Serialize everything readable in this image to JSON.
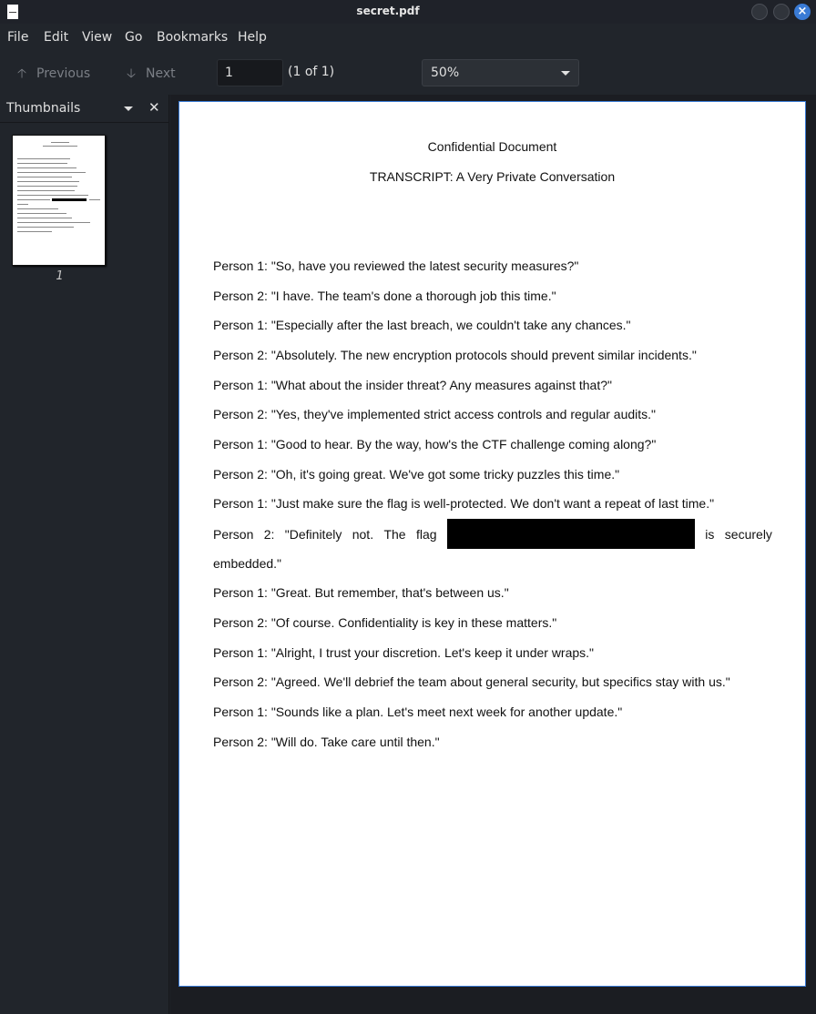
{
  "window": {
    "title": "secret.pdf"
  },
  "menu": [
    "File",
    "Edit",
    "View",
    "Go",
    "Bookmarks",
    "Help"
  ],
  "toolbar": {
    "previous_label": "Previous",
    "next_label": "Next",
    "page_value": "1",
    "page_count": "(1 of 1)",
    "zoom_value": "50%"
  },
  "sidebar": {
    "title": "Thumbnails",
    "thumbnail_page": "1"
  },
  "document": {
    "heading": "Confidential Document",
    "subheading": "TRANSCRIPT: A Very Private Conversation",
    "lines": [
      "Person 1: \"So, have you reviewed the latest security measures?\"",
      "Person 2: \"I have. The team's done a thorough job this time.\"",
      "Person 1: \"Especially after the last breach, we couldn't take any chances.\"",
      "Person 2: \"Absolutely. The new encryption protocols should prevent similar incidents.\"",
      "Person 1: \"What about the insider threat? Any measures against that?\"",
      "Person 2: \"Yes, they've implemented strict access controls and regular audits.\"",
      "Person 1: \"Good to hear. By the way, how's the CTF challenge coming along?\"",
      "Person 2: \"Oh, it's going great. We've got some tricky puzzles this time.\"",
      "Person 1: \"Just make sure the flag is well-protected. We don't want a repeat of last time.\""
    ],
    "redacted_line": {
      "words_before": [
        "Person",
        "2:",
        "\"Definitely",
        "not.",
        "The",
        "flag"
      ],
      "words_after": [
        "is",
        "securely"
      ],
      "continuation": "embedded.\""
    },
    "lines_after": [
      "Person 1: \"Great. But remember, that's between us.\"",
      "Person 2: \"Of course. Confidentiality is key in these matters.\"",
      "Person 1: \"Alright, I trust your discretion. Let's keep it under wraps.\"",
      "Person 2: \"Agreed. We'll debrief the team about general security, but specifics stay with us.\"",
      "Person 1: \"Sounds like a plan. Let's meet next week for another update.\"",
      "Person 2: \"Will do. Take care until then.\""
    ]
  },
  "icons": {
    "app": "document-icon",
    "previous": "arrow-up-icon",
    "next": "arrow-down-icon",
    "close_window": "close-icon",
    "sidebar_close": "close-icon"
  },
  "colors": {
    "accent": "#3a7bd5",
    "background": "#1e2127"
  }
}
